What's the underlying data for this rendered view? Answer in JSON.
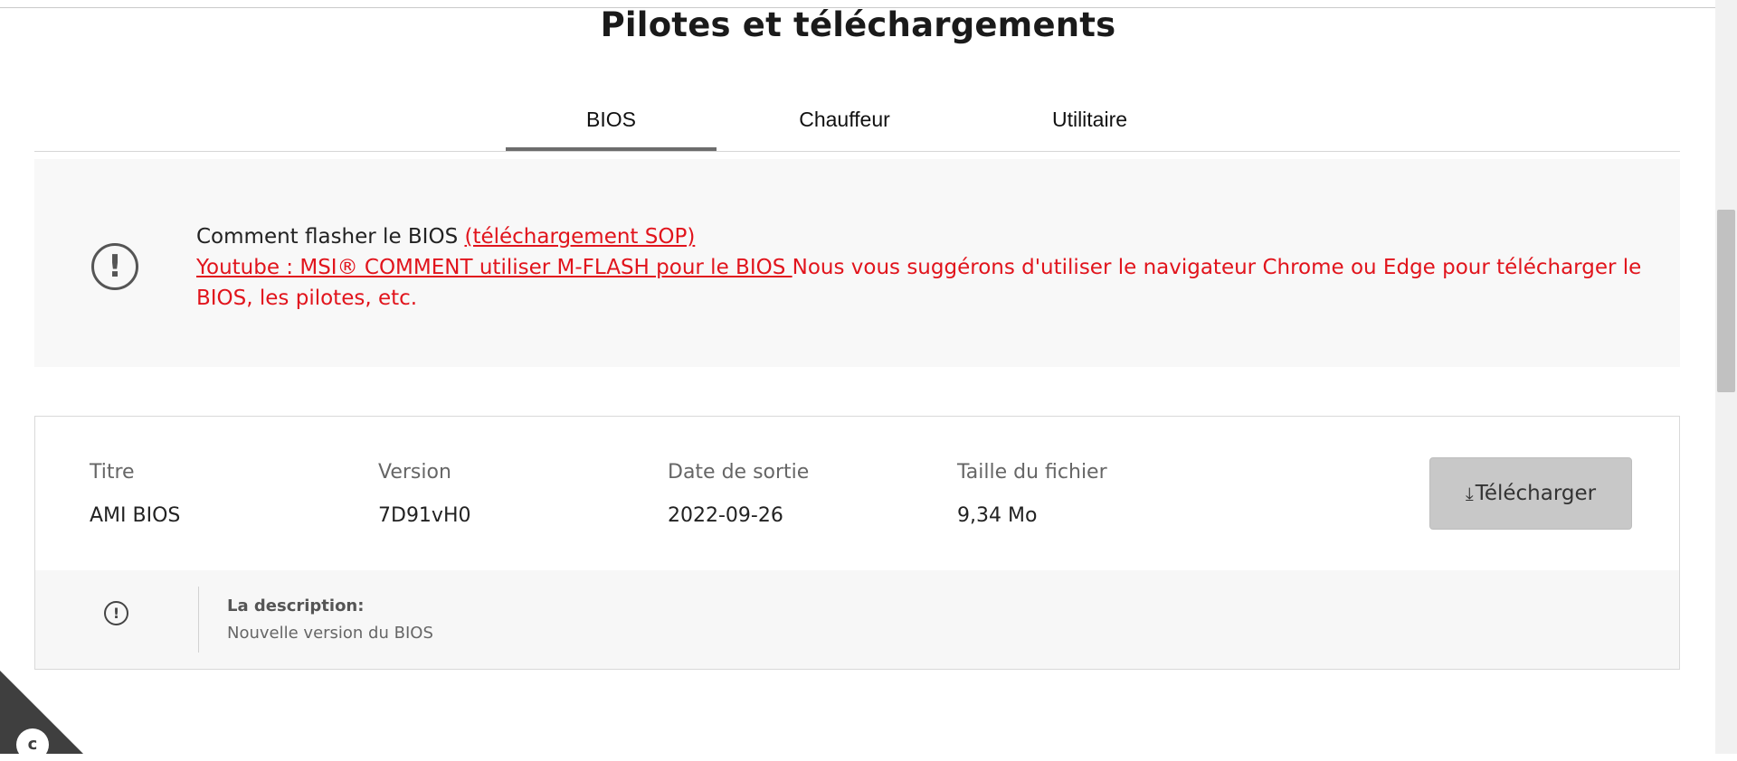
{
  "page": {
    "title": "Pilotes et téléchargements"
  },
  "tabs": [
    {
      "label": "BIOS",
      "active": true
    },
    {
      "label": "Chauffeur",
      "active": false
    },
    {
      "label": "Utilitaire",
      "active": false
    }
  ],
  "notice": {
    "icon": "exclamation-circle-icon",
    "line1_prefix": "Comment flasher le BIOS ",
    "line1_link": "(téléchargement SOP)",
    "line2_link": "Youtube : MSI® COMMENT utiliser M-FLASH pour le BIOS ",
    "line2_text": "Nous vous suggérons d'utiliser le navigateur Chrome ou Edge pour télécharger le BIOS, les pilotes, etc."
  },
  "table": {
    "headers": [
      "Titre",
      "Version",
      "Date de sortie",
      "Taille du fichier"
    ],
    "row": [
      "AMI BIOS",
      "7D91vH0",
      "2022-09-26",
      "9,34 Mo"
    ],
    "download_label": "Télécharger",
    "download_icon": "download-arrow-icon"
  },
  "description": {
    "icon": "exclamation-circle-icon",
    "label": "La description:",
    "text": "Nouvelle version du BIOS"
  },
  "colors": {
    "accent_red": "#e1141c",
    "button_gray": "#c8c8c8",
    "panel_bg": "#f8f8f8"
  },
  "corner_badge": {
    "icon": "gear-icon",
    "glyph": "c"
  }
}
